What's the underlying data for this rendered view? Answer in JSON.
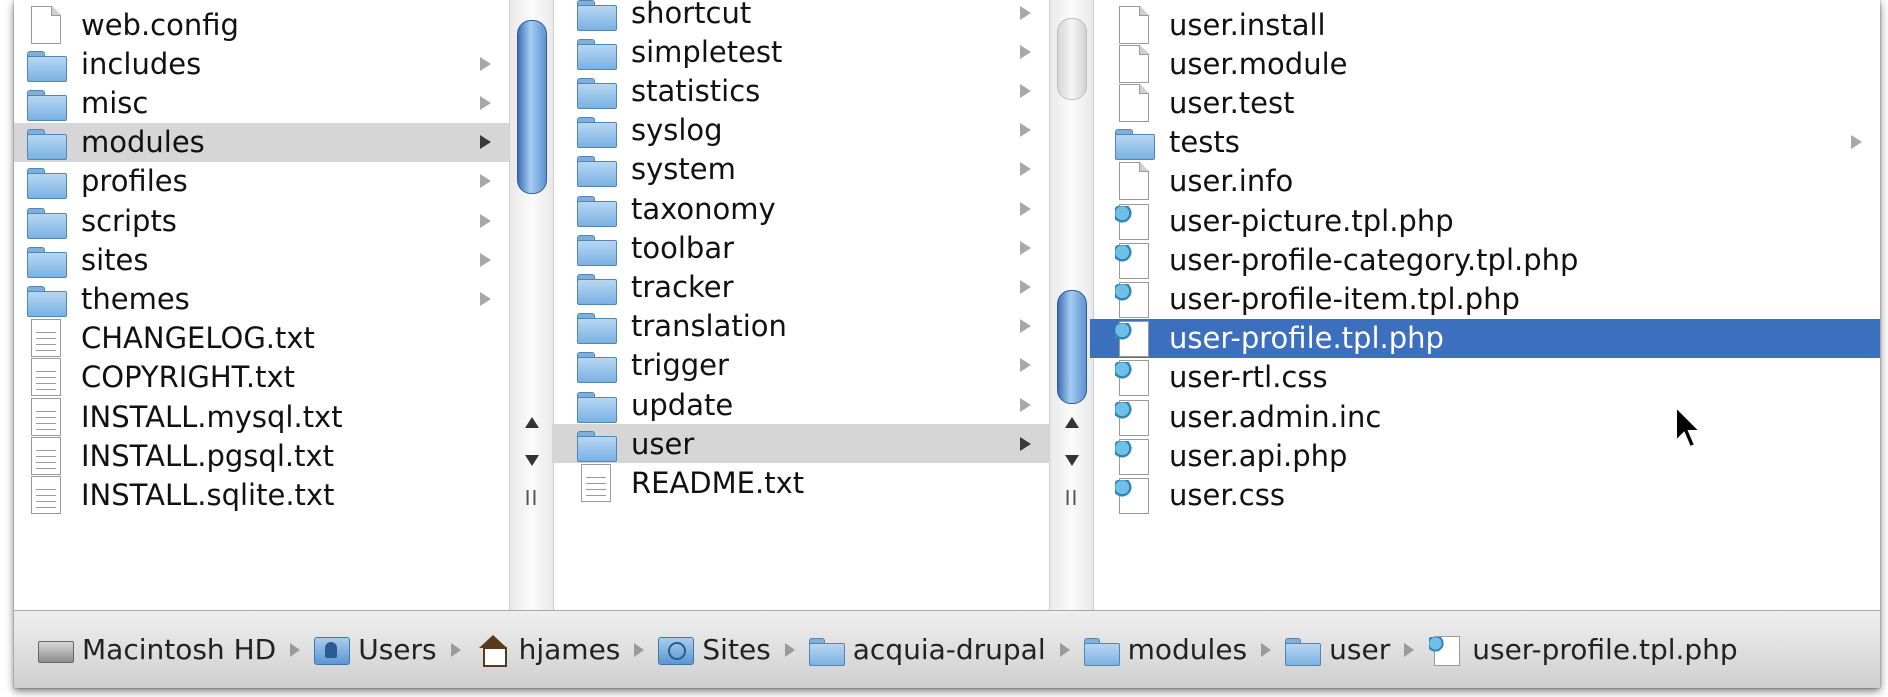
{
  "columns": {
    "col1": [
      {
        "label": "web.config",
        "type": "file",
        "arrow": false
      },
      {
        "label": "includes",
        "type": "folder",
        "arrow": true
      },
      {
        "label": "misc",
        "type": "folder",
        "arrow": true
      },
      {
        "label": "modules",
        "type": "folder",
        "arrow": true,
        "state": "selected-grey"
      },
      {
        "label": "profiles",
        "type": "folder",
        "arrow": true
      },
      {
        "label": "scripts",
        "type": "folder",
        "arrow": true
      },
      {
        "label": "sites",
        "type": "folder",
        "arrow": true
      },
      {
        "label": "themes",
        "type": "folder",
        "arrow": true
      },
      {
        "label": "CHANGELOG.txt",
        "type": "textfile",
        "arrow": false
      },
      {
        "label": "COPYRIGHT.txt",
        "type": "textfile",
        "arrow": false
      },
      {
        "label": "INSTALL.mysql.txt",
        "type": "textfile",
        "arrow": false
      },
      {
        "label": "INSTALL.pgsql.txt",
        "type": "textfile",
        "arrow": false
      },
      {
        "label": "INSTALL.sqlite.txt",
        "type": "textfile",
        "arrow": false
      }
    ],
    "col2": [
      {
        "label": "shortcut",
        "type": "folder",
        "arrow": true
      },
      {
        "label": "simpletest",
        "type": "folder",
        "arrow": true
      },
      {
        "label": "statistics",
        "type": "folder",
        "arrow": true
      },
      {
        "label": "syslog",
        "type": "folder",
        "arrow": true
      },
      {
        "label": "system",
        "type": "folder",
        "arrow": true
      },
      {
        "label": "taxonomy",
        "type": "folder",
        "arrow": true
      },
      {
        "label": "toolbar",
        "type": "folder",
        "arrow": true
      },
      {
        "label": "tracker",
        "type": "folder",
        "arrow": true
      },
      {
        "label": "translation",
        "type": "folder",
        "arrow": true
      },
      {
        "label": "trigger",
        "type": "folder",
        "arrow": true
      },
      {
        "label": "update",
        "type": "folder",
        "arrow": true
      },
      {
        "label": "user",
        "type": "folder",
        "arrow": true,
        "state": "selected-grey"
      },
      {
        "label": "README.txt",
        "type": "textfile",
        "arrow": false
      }
    ],
    "col3": [
      {
        "label": "user.install",
        "type": "file",
        "arrow": false
      },
      {
        "label": "user.module",
        "type": "file",
        "arrow": false
      },
      {
        "label": "user.test",
        "type": "file",
        "arrow": false
      },
      {
        "label": "tests",
        "type": "folder",
        "arrow": true
      },
      {
        "label": "user.info",
        "type": "file",
        "arrow": false
      },
      {
        "label": "user-picture.tpl.php",
        "type": "phpfile",
        "arrow": false
      },
      {
        "label": "user-profile-category.tpl.php",
        "type": "phpfile",
        "arrow": false
      },
      {
        "label": "user-profile-item.tpl.php",
        "type": "phpfile",
        "arrow": false
      },
      {
        "label": "user-profile.tpl.php",
        "type": "phpfile",
        "arrow": false,
        "state": "selected-blue"
      },
      {
        "label": "user-rtl.css",
        "type": "phpfile",
        "arrow": false
      },
      {
        "label": "user.admin.inc",
        "type": "phpfile",
        "arrow": false
      },
      {
        "label": "user.api.php",
        "type": "phpfile",
        "arrow": false
      },
      {
        "label": "user.css",
        "type": "phpfile",
        "arrow": false
      }
    ]
  },
  "pathbar": [
    {
      "label": "Macintosh HD",
      "icon": "hard-drive-icon"
    },
    {
      "label": "Users",
      "icon": "users-folder-icon"
    },
    {
      "label": "hjames",
      "icon": "home-icon"
    },
    {
      "label": "Sites",
      "icon": "sites-folder-icon"
    },
    {
      "label": "acquia-drupal",
      "icon": "folder-icon"
    },
    {
      "label": "modules",
      "icon": "folder-icon"
    },
    {
      "label": "user",
      "icon": "folder-icon"
    },
    {
      "label": "user-profile.tpl.php",
      "icon": "php-file-icon"
    }
  ],
  "colors": {
    "selection_blue": "#3d6fbf",
    "selection_grey": "#d6d6d6",
    "scroll_thumb": "#5d92d3"
  }
}
